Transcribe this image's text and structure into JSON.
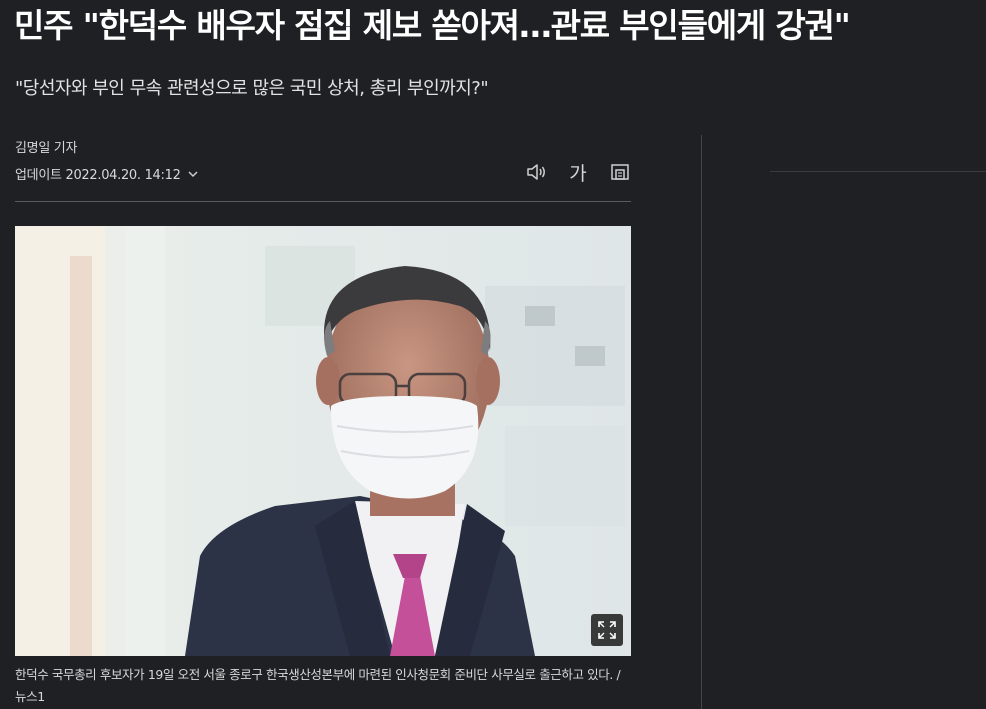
{
  "article": {
    "headline": "민주 \"한덕수 배우자 점집 제보 쏟아져…관료 부인들에게 강권\"",
    "subtitle": "\"당선자와 부인 무속 관련성으로 많은 국민 상처, 총리 부인까지?\"",
    "byline": "김명일 기자",
    "updated": "업데이트 2022.04.20. 14:12",
    "caption": "한덕수 국무총리 후보자가 19일 오전 서울 종로구 한국생산성본부에 마련된 인사청문회 준비단 사무실로 출근하고 있다. /뉴스1"
  },
  "toolbar": {
    "font_label": "가"
  },
  "icons": [
    "chevron-down-icon",
    "speaker-icon",
    "font-size-icon",
    "print-icon",
    "expand-icon"
  ],
  "colors": {
    "background": "#1f2023",
    "text": "#ffffff"
  }
}
